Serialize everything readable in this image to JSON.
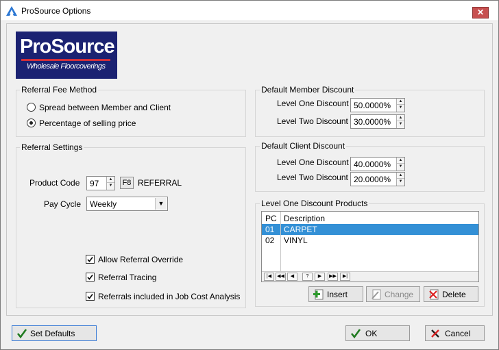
{
  "window": {
    "title": "ProSource Options",
    "close_glyph": "✕"
  },
  "logo": {
    "main": "ProSource",
    "tagline": "Wholesale Floorcoverings"
  },
  "referral_fee_method": {
    "title": "Referral Fee Method",
    "options": [
      {
        "label": "Spread between Member and Client",
        "selected": false
      },
      {
        "label": "Percentage of selling price",
        "selected": true
      }
    ]
  },
  "referral_settings": {
    "title": "Referral Settings",
    "product_code_label": "Product Code",
    "product_code_value": "97",
    "lookup_key": "F8",
    "product_name": "REFERRAL",
    "pay_cycle_label": "Pay Cycle",
    "pay_cycle_value": "Weekly",
    "checkboxes": [
      {
        "label": "Allow Referral Override",
        "checked": true
      },
      {
        "label": "Referral Tracing",
        "checked": true
      },
      {
        "label": "Referrals included in Job Cost Analysis",
        "checked": true
      }
    ]
  },
  "default_member_discount": {
    "title": "Default Member Discount",
    "level_one_label": "Level One Discount",
    "level_one_value": "50.0000%",
    "level_two_label": "Level Two Discount",
    "level_two_value": "30.0000%"
  },
  "default_client_discount": {
    "title": "Default Client Discount",
    "level_one_label": "Level One Discount",
    "level_one_value": "40.0000%",
    "level_two_label": "Level Two Discount",
    "level_two_value": "20.0000%"
  },
  "level_one_products": {
    "title": "Level One Discount Products",
    "columns": [
      "PC",
      "Description"
    ],
    "rows": [
      {
        "pc": "01",
        "description": "CARPET",
        "selected": true
      },
      {
        "pc": "02",
        "description": "VINYL",
        "selected": false
      }
    ],
    "nav": [
      "|◀",
      "◀◀",
      "◀",
      "?",
      "▶",
      "▶▶",
      "▶|"
    ],
    "insert_label": "Insert",
    "change_label": "Change",
    "delete_label": "Delete"
  },
  "footer": {
    "set_defaults_label": "Set Defaults",
    "ok_label": "OK",
    "cancel_label": "Cancel"
  },
  "colors": {
    "selection": "#3390d6",
    "logo_bg": "#1b2272",
    "logo_accent": "#d12f3a"
  }
}
